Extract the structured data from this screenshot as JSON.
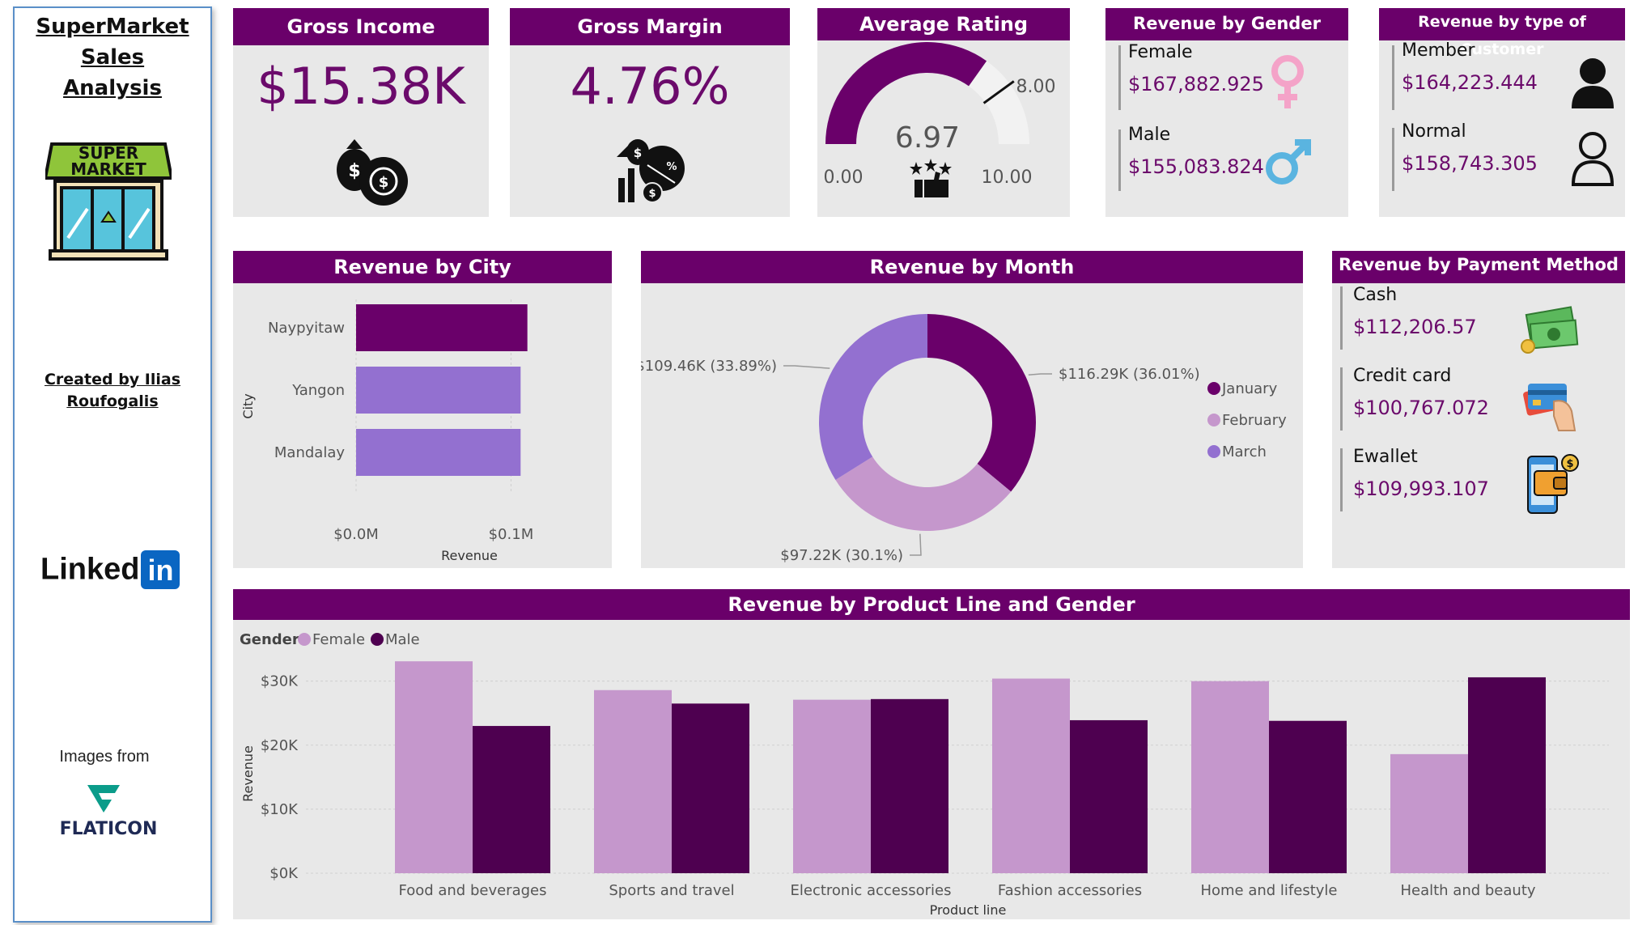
{
  "sidebar": {
    "title_line1": "SuperMarket Sales",
    "title_line2": "Analysis",
    "logo_text_line1": "SUPER",
    "logo_text_line2": "MARKET",
    "credit_line1": "Created by Ilias",
    "credit_line2": "Roufogalis",
    "linkedin_text": "Linked",
    "linkedin_in": "in",
    "images_from": "Images from",
    "flaticon": "FLATICON"
  },
  "kpis": {
    "gross_income": {
      "title": "Gross Income",
      "value": "$15.38K"
    },
    "gross_margin": {
      "title": "Gross Margin",
      "value": "4.76%"
    },
    "average_rating": {
      "title": "Average Rating",
      "value": "6.97",
      "min": "0.00",
      "max": "10.00",
      "target": "8.00",
      "value_num": 6.97,
      "min_num": 0,
      "max_num": 10,
      "target_num": 8
    }
  },
  "gender_card": {
    "title": "Revenue by Gender",
    "female_label": "Female",
    "female_value": "$167,882.925",
    "male_label": "Male",
    "male_value": "$155,083.824"
  },
  "customer_card": {
    "title": "Revenue by type of Customer",
    "member_label": "Member",
    "member_value": "$164,223.444",
    "normal_label": "Normal",
    "normal_value": "$158,743.305"
  },
  "payment_card": {
    "title": "Revenue by Payment Method",
    "cash_label": "Cash",
    "cash_value": "$112,206.57",
    "credit_label": "Credit card",
    "credit_value": "$100,767.072",
    "ewallet_label": "Ewallet",
    "ewallet_value": "$109,993.107"
  },
  "colors": {
    "header": "#6a006a",
    "dark_purple": "#6a006a",
    "medium_purple": "#9370d0",
    "light_purple": "#c597cc",
    "deep_purple": "#4e0050"
  },
  "chart_data": [
    {
      "id": "city",
      "type": "bar",
      "orientation": "horizontal",
      "title": "Revenue by City",
      "xlabel": "Revenue",
      "ylabel": "City",
      "categories": [
        "Naypyitaw",
        "Yangon",
        "Mandalay"
      ],
      "values": [
        110568.7,
        106200.4,
        106197.7
      ],
      "xticks": [
        "$0.0M",
        "$0.1M"
      ],
      "xlim": [
        0,
        140000
      ],
      "grid": true
    },
    {
      "id": "month",
      "type": "pie",
      "donut": true,
      "title": "Revenue by Month",
      "categories": [
        "January",
        "February",
        "March"
      ],
      "values": [
        116290,
        97220,
        109460
      ],
      "labels": [
        "$116.29K (36.01%)",
        "$97.22K (30.1%)",
        "$109.46K (33.89%)"
      ],
      "legend_position": "right"
    },
    {
      "id": "product",
      "type": "bar",
      "title": "Revenue by Product Line and Gender",
      "xlabel": "Product line",
      "ylabel": "Revenue",
      "legend_title": "Gender",
      "legend_position": "top-left",
      "categories": [
        "Food and beverages",
        "Sports and travel",
        "Electronic accessories",
        "Fashion accessories",
        "Home and lifestyle",
        "Health and beauty"
      ],
      "series": [
        {
          "name": "Female",
          "values": [
            33100,
            28600,
            27100,
            30400,
            30000,
            18600
          ]
        },
        {
          "name": "Male",
          "values": [
            23000,
            26500,
            27200,
            23900,
            23800,
            30600
          ]
        }
      ],
      "yticks": [
        "$0K",
        "$10K",
        "$20K",
        "$30K"
      ],
      "ylim": [
        0,
        33500
      ],
      "grid": true
    }
  ]
}
